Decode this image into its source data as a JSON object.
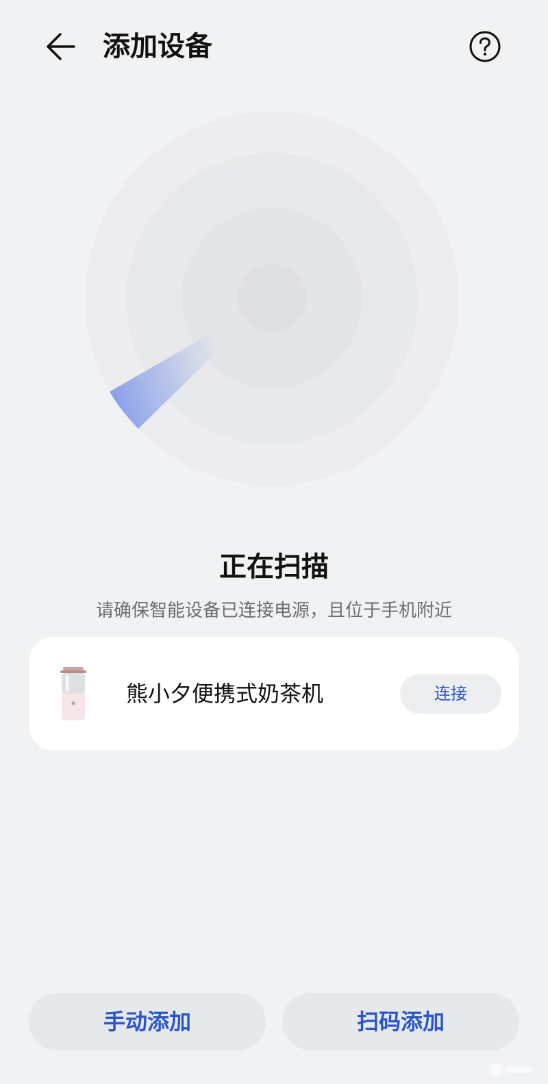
{
  "header": {
    "title": "添加设备",
    "back_icon": "back-arrow-icon",
    "help_icon": "question-circle-icon"
  },
  "scan": {
    "status": "正在扫描",
    "hint": "请确保智能设备已连接电源，且位于手机附近"
  },
  "device": {
    "name": "熊小夕便携式奶茶机",
    "icon": "milk-tea-machine-image",
    "connect_label": "连接"
  },
  "actions": {
    "manual_label": "手动添加",
    "scan_label": "扫码添加"
  },
  "colors": {
    "background": "#f1f2f4",
    "accent": "#2a56c6",
    "card": "#ffffff",
    "sweep": "#7f97e8"
  }
}
